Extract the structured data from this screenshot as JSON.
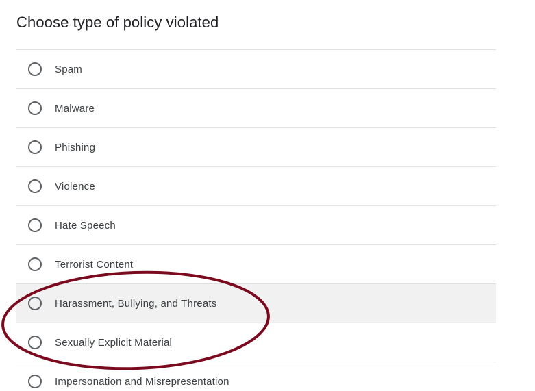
{
  "title": "Choose type of policy violated",
  "options": [
    {
      "label": "Spam"
    },
    {
      "label": "Malware"
    },
    {
      "label": "Phishing"
    },
    {
      "label": "Violence"
    },
    {
      "label": "Hate Speech"
    },
    {
      "label": "Terrorist Content"
    },
    {
      "label": "Harassment, Bullying, and Threats",
      "hovered": true
    },
    {
      "label": "Sexually Explicit Material"
    },
    {
      "label": "Impersonation and Misrepresentation"
    }
  ],
  "colors": {
    "annotation_ellipse": "#7b0a1e",
    "hover_background": "#f1f1f1",
    "divider": "#e0e0e0",
    "radio_border": "#5f6368"
  }
}
